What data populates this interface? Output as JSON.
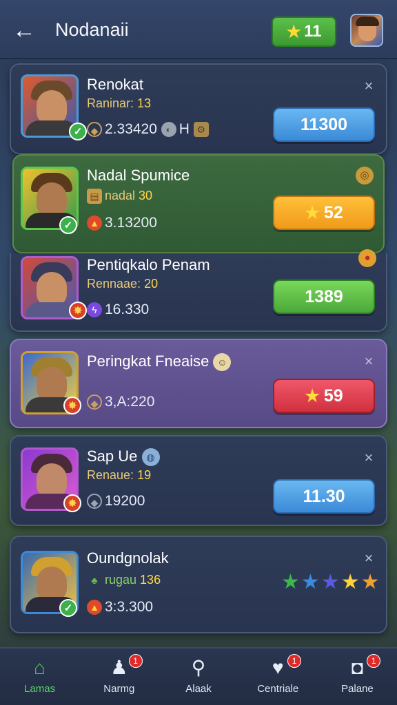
{
  "header": {
    "back_icon": "arrow-left-icon",
    "title": "Nodanaii",
    "star_count": "11"
  },
  "entries": [
    {
      "name": "Renokat",
      "rank_label": "Raninar: ",
      "rank_value": "13",
      "points": "2.33420",
      "points_extra": "H",
      "action": "11300",
      "action_style": "blue"
    },
    {
      "name": "Nadal Spumice",
      "rank_label": "nadal ",
      "rank_value": "30",
      "points": "3.13200",
      "action": "52",
      "action_style": "orange"
    },
    {
      "name": "Pentiqkalo Penam",
      "rank_label": "Rennaae: ",
      "rank_value": "20",
      "points": "16.330",
      "action": "1389",
      "action_style": "green"
    },
    {
      "name": "Peringkat Fneaise",
      "points": "3,A:220",
      "action": "59",
      "action_style": "red"
    },
    {
      "name": "Sap Ue",
      "rank_label": "Renaue: ",
      "rank_value": "19",
      "points": "19200",
      "action": "11.30",
      "action_style": "blue"
    },
    {
      "name": "Oundgnolak",
      "rank_label": "rugau ",
      "rank_value": "136",
      "points": "3:3.300",
      "stars": [
        "#3cb84a",
        "#3a8ae0",
        "#5a5ae0",
        "#ffd23a",
        "#f0a030"
      ]
    }
  ],
  "bottom_nav": [
    {
      "label": "Lamas",
      "icon": "home-icon",
      "badge": ""
    },
    {
      "label": "Narmg",
      "icon": "player-icon",
      "badge": "1"
    },
    {
      "label": "Alaak",
      "icon": "search-icon",
      "badge": ""
    },
    {
      "label": "Centriale",
      "icon": "heart-icon",
      "badge": "1"
    },
    {
      "label": "Palane",
      "icon": "camera-icon",
      "badge": "1"
    }
  ],
  "colors": {
    "accent_green": "#4ac85a",
    "gold": "#ffd84a"
  }
}
